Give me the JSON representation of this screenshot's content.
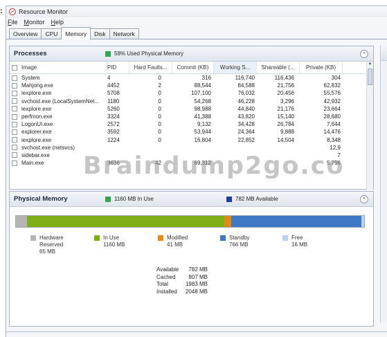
{
  "window": {
    "title": "Resource Monitor",
    "stray_char": ":"
  },
  "menu": [
    "File",
    "Monitor",
    "Help"
  ],
  "tabs": [
    {
      "label": "Overview",
      "active": false
    },
    {
      "label": "CPU",
      "active": false
    },
    {
      "label": "Memory",
      "active": true
    },
    {
      "label": "Disk",
      "active": false
    },
    {
      "label": "Network",
      "active": false
    }
  ],
  "processes": {
    "title": "Processes",
    "status": "58% Used Physical Memory",
    "status_color": "#2fa84f",
    "collapse_glyph": "^",
    "columns": [
      "Image",
      "PID",
      "Hard Faults...",
      "Commit (KB)",
      "Working S...",
      "Shareable (...",
      "Private (KB)"
    ],
    "rows": [
      [
        "System",
        "4",
        "0",
        "316",
        "116,740",
        "116,436",
        "304"
      ],
      [
        "Mahjong.exe",
        "4452",
        "2",
        "88,544",
        "84,588",
        "21,756",
        "62,832"
      ],
      [
        "iexplore.exe",
        "5708",
        "0",
        "107,100",
        "76,032",
        "20,456",
        "55,576"
      ],
      [
        "svchost.exe (LocalSystemNet...",
        "1180",
        "0",
        "54,268",
        "46,228",
        "3,296",
        "42,932"
      ],
      [
        "iexplore.exe",
        "5260",
        "0",
        "98,988",
        "44,840",
        "21,176",
        "23,664"
      ],
      [
        "perfmon.exe",
        "3324",
        "0",
        "41,388",
        "43,820",
        "15,140",
        "28,680"
      ],
      [
        "LogonUI.exe",
        "2572",
        "0",
        "9,132",
        "34,428",
        "26,784",
        "7,644"
      ],
      [
        "explorer.exe",
        "3592",
        "0",
        "53,944",
        "24,364",
        "9,888",
        "14,476"
      ],
      [
        "iexplore.exe",
        "1224",
        "0",
        "16,804",
        "22,852",
        "14,504",
        "8,348"
      ],
      [
        "svchost.exe (netsvcs)",
        "",
        "",
        "",
        "",
        "",
        "12,9"
      ],
      [
        "sidebar.exe",
        "",
        "",
        "",
        "",
        "",
        "7"
      ],
      [
        "Main.exe",
        "3636",
        "42",
        "69,312",
        "",
        "",
        "5,796"
      ]
    ]
  },
  "physical_memory": {
    "title": "Physical Memory",
    "in_use_stat": "1160 MB In Use",
    "in_use_color": "#2fa84f",
    "available_stat": "782 MB Available",
    "available_color": "#1f3f9a",
    "collapse_glyph": "^",
    "bar": [
      {
        "name": "Hardware Reserved",
        "mb": 65,
        "color": "#b5b5b5"
      },
      {
        "name": "In Use",
        "mb": 1160,
        "color": "#7fae16"
      },
      {
        "name": "Modified",
        "mb": 41,
        "color": "#e2891c"
      },
      {
        "name": "Standby",
        "mb": 766,
        "color": "#3f78c4"
      },
      {
        "name": "Free",
        "mb": 16,
        "color": "#b9d0ee"
      }
    ],
    "legend": [
      {
        "label": "Hardware",
        "label2": "Reserved",
        "value": "65 MB",
        "color": "#b5b5b5"
      },
      {
        "label": "In Use",
        "label2": "",
        "value": "1160 MB",
        "color": "#7fae16"
      },
      {
        "label": "Modified",
        "label2": "",
        "value": "41 MB",
        "color": "#e2891c"
      },
      {
        "label": "Standby",
        "label2": "",
        "value": "766 MB",
        "color": "#3f78c4"
      },
      {
        "label": "Free",
        "label2": "",
        "value": "16 MB",
        "color": "#b9d0ee"
      }
    ],
    "totals": [
      {
        "label": "Available",
        "value": "782 MB"
      },
      {
        "label": "Cached",
        "value": "807 MB"
      },
      {
        "label": "Total",
        "value": "1983 MB"
      },
      {
        "label": "Installed",
        "value": "2048 MB"
      }
    ]
  },
  "watermark": "Braindump2go.co"
}
